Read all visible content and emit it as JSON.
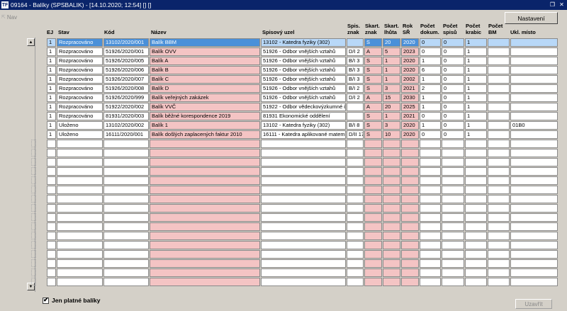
{
  "window": {
    "title": "09164 - Balíky (SPSBALIK) - [14.10.2020; 12:54]  [] []",
    "app_icon": "TF"
  },
  "nav": {
    "label": "Nav",
    "icon": "nav-arrow-icon"
  },
  "toolbar": {
    "settings_label": "Nastavení"
  },
  "columns": [
    {
      "key": "ej",
      "label": "EJ"
    },
    {
      "key": "stav",
      "label": "Stav"
    },
    {
      "key": "kod",
      "label": "Kód"
    },
    {
      "key": "nazev",
      "label": "Název"
    },
    {
      "key": "uzel",
      "label": "Spisový uzel"
    },
    {
      "key": "znak",
      "label": "Spis.\nznak"
    },
    {
      "key": "skznak",
      "label": "Skart.\nznak"
    },
    {
      "key": "lhuta",
      "label": "Skart.\nlhůta"
    },
    {
      "key": "rok",
      "label": "Rok\nSŘ"
    },
    {
      "key": "dokum",
      "label": "Počet\ndokum."
    },
    {
      "key": "spisu",
      "label": "Počet\nspisů"
    },
    {
      "key": "krabic",
      "label": "Počet\nkrabic"
    },
    {
      "key": "bm",
      "label": "Počet\nBM"
    },
    {
      "key": "misto",
      "label": "Ukl. místo"
    }
  ],
  "rows": [
    {
      "ej": "1",
      "stav": "Rozpracováno",
      "kod": "13102/2020/001",
      "nazev": "Balík BBM",
      "uzel": "13102 - Katedra  fyziky (302)",
      "znak": "",
      "skznak": "S",
      "lhuta": "20",
      "rok": "2020",
      "dokum": "0",
      "spisu": "0",
      "krabic": "1",
      "bm": "",
      "misto": ""
    },
    {
      "ej": "1",
      "stav": "Rozpracováno",
      "kod": "51926/2020/001",
      "nazev": "Balík OVV",
      "uzel": "51926 - Odbor vnějších vztahů",
      "znak": "D/I 2",
      "skznak": "A",
      "lhuta": "5",
      "rok": "2023",
      "dokum": "0",
      "spisu": "0",
      "krabic": "1",
      "bm": "",
      "misto": ""
    },
    {
      "ej": "1",
      "stav": "Rozpracováno",
      "kod": "51926/2020/005",
      "nazev": "Balík A",
      "uzel": "51926 - Odbor vnějších vztahů",
      "znak": "B/I 3",
      "skznak": "S",
      "lhuta": "1",
      "rok": "2020",
      "dokum": "1",
      "spisu": "0",
      "krabic": "1",
      "bm": "",
      "misto": ""
    },
    {
      "ej": "1",
      "stav": "Rozpracováno",
      "kod": "51926/2020/006",
      "nazev": "Balík B",
      "uzel": "51926 - Odbor vnějších vztahů",
      "znak": "B/I 3",
      "skznak": "S",
      "lhuta": "1",
      "rok": "2020",
      "dokum": "6",
      "spisu": "0",
      "krabic": "1",
      "bm": "",
      "misto": ""
    },
    {
      "ej": "1",
      "stav": "Rozpracováno",
      "kod": "51926/2020/007",
      "nazev": "Balík C",
      "uzel": "51926 - Odbor vnějších vztahů",
      "znak": "B/I 3",
      "skznak": "S",
      "lhuta": "1",
      "rok": "2002",
      "dokum": "1",
      "spisu": "0",
      "krabic": "1",
      "bm": "",
      "misto": ""
    },
    {
      "ej": "1",
      "stav": "Rozpracováno",
      "kod": "51926/2020/008",
      "nazev": "Balík D",
      "uzel": "51926 - Odbor vnějších vztahů",
      "znak": "B/I 2",
      "skznak": "S",
      "lhuta": "3",
      "rok": "2021",
      "dokum": "2",
      "spisu": "0",
      "krabic": "1",
      "bm": "",
      "misto": ""
    },
    {
      "ej": "1",
      "stav": "Rozpracováno",
      "kod": "51926/2020/999",
      "nazev": "Balík veřejných zakázek",
      "uzel": "51926 - Odbor vnějších vztahů",
      "znak": "D/I 2",
      "skznak": "A",
      "lhuta": "15",
      "rok": "2030",
      "dokum": "1",
      "spisu": "0",
      "krabic": "1",
      "bm": "",
      "misto": ""
    },
    {
      "ej": "1",
      "stav": "Rozpracováno",
      "kod": "51922/2020/002",
      "nazev": "Balík VVČ",
      "uzel": "51922 - Odbor vědeckovýzkumné č",
      "znak": "",
      "skznak": "A",
      "lhuta": "20",
      "rok": "2025",
      "dokum": "1",
      "spisu": "0",
      "krabic": "1",
      "bm": "",
      "misto": ""
    },
    {
      "ej": "1",
      "stav": "Rozpracováno",
      "kod": "81931/2020/003",
      "nazev": "Balík běžné korespondence 2019",
      "uzel": "81931 Ekonomické oddělení",
      "znak": "",
      "skznak": "S",
      "lhuta": "1",
      "rok": "2021",
      "dokum": "0",
      "spisu": "0",
      "krabic": "1",
      "bm": "",
      "misto": ""
    },
    {
      "ej": "1",
      "stav": "Uloženo",
      "kod": "13102/2020/002",
      "nazev": "Balík 1",
      "uzel": "13102 - Katedra  fyziky (302)",
      "znak": "B/I 8",
      "skznak": "S",
      "lhuta": "3",
      "rok": "2020",
      "dokum": "1",
      "spisu": "0",
      "krabic": "1",
      "bm": "",
      "misto": "01B0"
    },
    {
      "ej": "1",
      "stav": "Uloženo",
      "kod": "16111/2020/001",
      "nazev": "Balík došlých zaplacených faktur 2010",
      "uzel": "16111 - Katedra aplikované matem",
      "znak": "D/II 17",
      "skznak": "S",
      "lhuta": "10",
      "rok": "2020",
      "dokum": "0",
      "spisu": "0",
      "krabic": "1",
      "bm": "",
      "misto": ""
    }
  ],
  "footer": {
    "checkbox_label": "Jen platné balíky",
    "checkbox_checked": true,
    "close_label": "Uzavřít"
  },
  "colors": {
    "selection": "#4a90d9",
    "required_field": "#f4c4c4",
    "titlebar": "#0a246a"
  }
}
